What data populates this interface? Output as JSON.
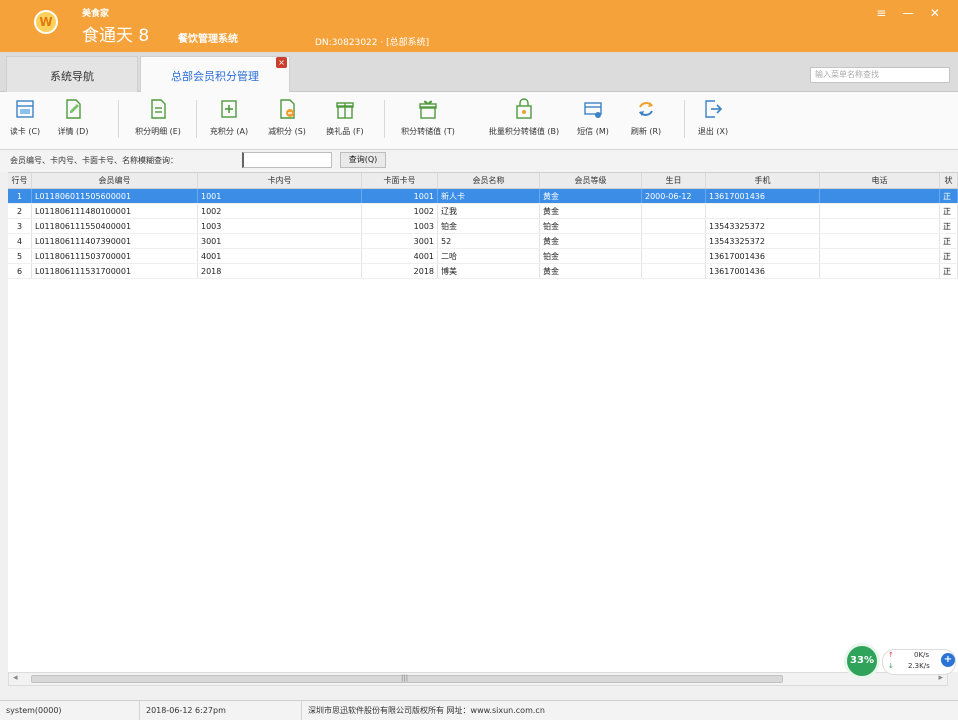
{
  "titlebar": {
    "logo": "W",
    "brand_small": "美食家",
    "brand_large": "食通天 8",
    "brand_sub": "餐饮管理系统",
    "dn": "DN:30823022 · [总部系统]",
    "window_controls": "≡ — ✕"
  },
  "tabs": {
    "nav": "系统导航",
    "active": "总部会员积分管理",
    "close": "×"
  },
  "search": {
    "placeholder": "输入菜单名称查找"
  },
  "toolbar": [
    {
      "label": "读卡 (C)",
      "icon": "card-reader-icon"
    },
    {
      "label": "详情 (D)",
      "icon": "detail-icon"
    },
    {
      "label": "积分明细 (E)",
      "icon": "points-detail-icon"
    },
    {
      "label": "充积分 (A)",
      "icon": "add-points-icon"
    },
    {
      "label": "减积分 (S)",
      "icon": "deduct-points-icon"
    },
    {
      "label": "换礼品 (F)",
      "icon": "gift-icon"
    },
    {
      "label": "积分转储值 (T)",
      "icon": "convert-icon"
    },
    {
      "label": "批量积分转储值 (B)",
      "icon": "batch-convert-icon"
    },
    {
      "label": "短信 (M)",
      "icon": "sms-icon"
    },
    {
      "label": "刷新 (R)",
      "icon": "refresh-icon"
    },
    {
      "label": "退出 (X)",
      "icon": "exit-icon"
    }
  ],
  "query": {
    "label": "会员编号、卡内号、卡面卡号、名称模糊查询：",
    "value": "",
    "button": "查询(Q)"
  },
  "grid": {
    "columns": [
      "行号",
      "会员编号",
      "卡内号",
      "卡面卡号",
      "会员名称",
      "会员等级",
      "生日",
      "手机",
      "电话",
      "状"
    ],
    "rows": [
      [
        "1",
        "L011806011505600001",
        "1001",
        "1001",
        "新人卡",
        "黄金",
        "2000-06-12",
        "13617001436",
        "",
        "正"
      ],
      [
        "2",
        "L011806111480100001",
        "1002",
        "1002",
        "辽我",
        "黄金",
        "",
        "",
        "",
        "正"
      ],
      [
        "3",
        "L011806111550400001",
        "1003",
        "1003",
        "铂金",
        "铂金",
        "",
        "13543325372",
        "",
        "正"
      ],
      [
        "4",
        "L011806111407390001",
        "3001",
        "3001",
        "52",
        "黄金",
        "",
        "13543325372",
        "",
        "正"
      ],
      [
        "5",
        "L011806111503700001",
        "4001",
        "4001",
        "二哈",
        "铂金",
        "",
        "13617001436",
        "",
        "正"
      ],
      [
        "6",
        "L011806111531700001",
        "2018",
        "2018",
        "博美",
        "黄金",
        "",
        "13617001436",
        "",
        "正"
      ]
    ],
    "selected_row": 0
  },
  "network": {
    "percent": "33%",
    "up_arrow": "↑",
    "up_speed": "0K/s",
    "down_arrow": "↓",
    "down_speed": "2.3K/s",
    "plus": "+"
  },
  "statusbar": {
    "user": "system(0000)",
    "datetime": "2018-06-12 6:27pm",
    "copyright": "深圳市思迅软件股份有限公司版权所有 网址：www.sixun.com.cn"
  }
}
